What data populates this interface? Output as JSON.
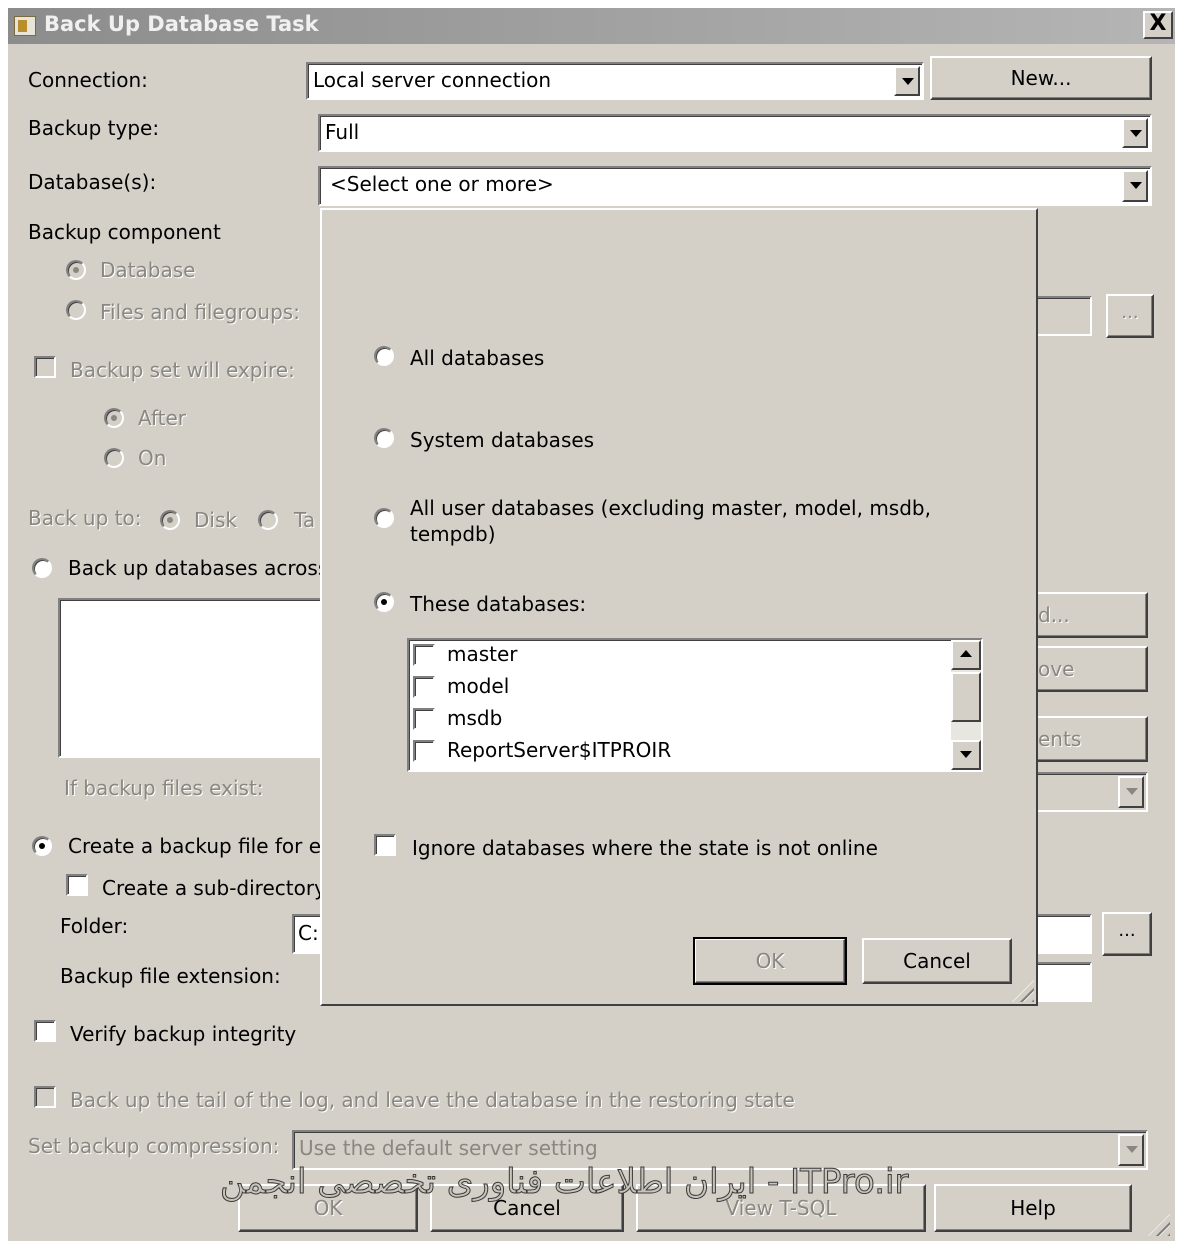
{
  "window": {
    "title": "Back Up Database Task",
    "close_label": "X"
  },
  "connection": {
    "label": "Connection:",
    "value": "Local server connection",
    "new_button": "New..."
  },
  "backup_type": {
    "label": "Backup type:",
    "value": "Full"
  },
  "databases": {
    "label": "Database(s):",
    "value": "<Select one or more>"
  },
  "backup_component": {
    "label": "Backup component",
    "database_option": "Database",
    "files_option": "Files and filegroups:",
    "browse_label": "..."
  },
  "expire": {
    "label": "Backup set will expire:",
    "after": "After",
    "on": "On"
  },
  "backup_to": {
    "label": "Back up to:",
    "disk": "Disk",
    "tape": "Ta"
  },
  "across": {
    "label": "Back up databases across",
    "add_button": "d...",
    "remove_button": "ove",
    "contents_button": "ents"
  },
  "if_exist": {
    "label": "If backup files exist:"
  },
  "create_file": {
    "label": "Create a backup file for e",
    "subdir_label": "Create a sub-directory",
    "folder_label": "Folder:",
    "folder_value": "C:",
    "folder_browse": "...",
    "extension_label": "Backup file extension:"
  },
  "verify": {
    "label": "Verify backup integrity"
  },
  "tail_log": {
    "label": "Back up the tail of the log, and leave the database in the restoring state"
  },
  "compression": {
    "label": "Set backup compression:",
    "value": "Use the default server setting"
  },
  "footer": {
    "ok": "OK",
    "cancel": "Cancel",
    "view_tsql": "View T-SQL",
    "help": "Help"
  },
  "popup": {
    "all_databases": "All databases",
    "system_databases": "System databases",
    "all_user_line1": "All user databases  (excluding master, model, msdb,",
    "all_user_line2": "tempdb)",
    "these_databases": "These databases:",
    "items": [
      "master",
      "model",
      "msdb",
      "ReportServer$ITPROIR"
    ],
    "ignore_offline": "Ignore databases where the state is not online",
    "ok": "OK",
    "cancel": "Cancel"
  },
  "watermark": "ایران اطلاعات فناوری تخصصی انجمن - ITPro.ir"
}
